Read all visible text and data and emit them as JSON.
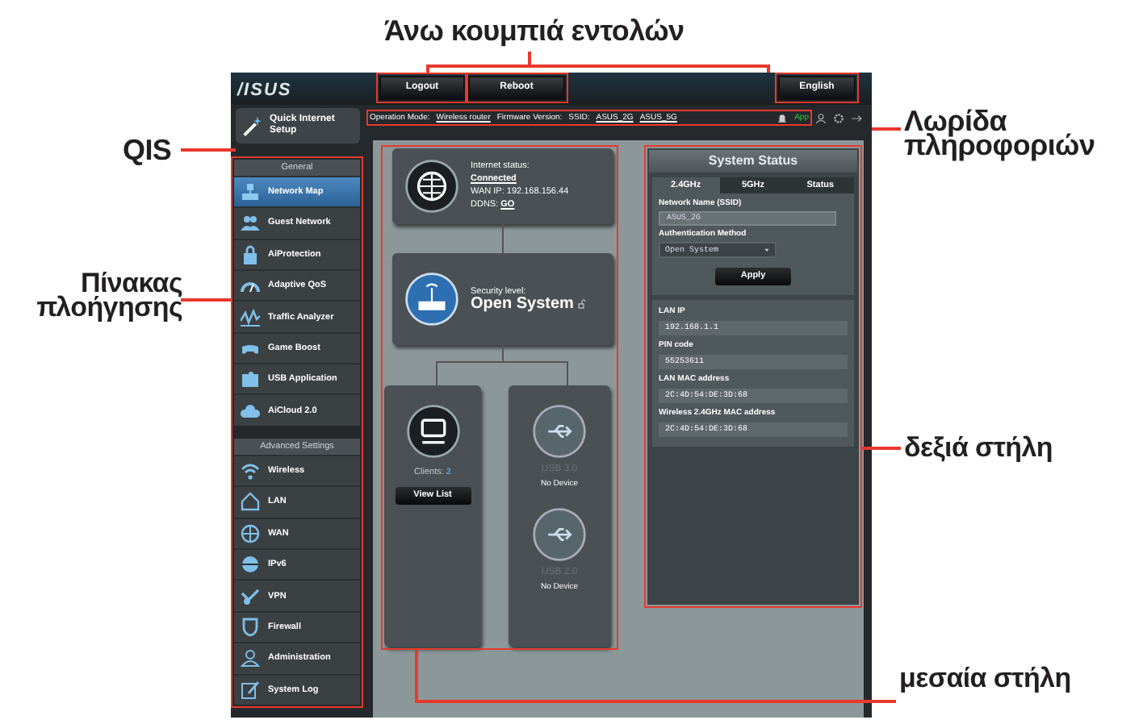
{
  "annotations": [
    {
      "text": "Άνω κουμπιά εντολών"
    },
    {
      "text": "QIS"
    },
    {
      "text": "Πίνακας πλοήγησης"
    },
    {
      "text": "Λωρίδα πληροφοριών"
    },
    {
      "text": "δεξιά στήλη"
    },
    {
      "text": "μεσαία στήλη"
    }
  ],
  "header": {
    "logo": "/ISUS",
    "buttons": [
      "Logout",
      "Reboot",
      "English"
    ]
  },
  "qis": {
    "label": "Quick Internet Setup"
  },
  "sidebar": {
    "sections": [
      {
        "title": "General",
        "items": [
          {
            "label": "Network Map",
            "selected": true
          },
          {
            "label": "Guest Network",
            "selected": false
          },
          {
            "label": "AiProtection",
            "selected": false
          },
          {
            "label": "Adaptive QoS",
            "selected": false
          },
          {
            "label": "Traffic Analyzer",
            "selected": false
          },
          {
            "label": "Game Boost",
            "selected": false
          },
          {
            "label": "USB Application",
            "selected": false
          },
          {
            "label": "AiCloud 2.0",
            "selected": false
          }
        ]
      },
      {
        "title": "Advanced Settings",
        "items": [
          {
            "label": "Wireless",
            "selected": false
          },
          {
            "label": "LAN",
            "selected": false
          },
          {
            "label": "WAN",
            "selected": false
          },
          {
            "label": "IPv6",
            "selected": false
          },
          {
            "label": "VPN",
            "selected": false
          },
          {
            "label": "Firewall",
            "selected": false
          },
          {
            "label": "Administration",
            "selected": false
          },
          {
            "label": "System Log",
            "selected": false
          }
        ]
      }
    ]
  },
  "info_bar": {
    "mode_label": "Operation Mode:",
    "mode": "Wireless router",
    "firmware_label": "Firmware Version:",
    "ssid_label": "SSID:",
    "ssids": [
      "ASUS_2G",
      "ASUS_5G"
    ],
    "app": "App"
  },
  "network_map": {
    "internet": {
      "status_label": "Internet status:",
      "status": "Connected",
      "wan_ip": "WAN IP: 192.168.156.44",
      "ddns_label": "DDNS:",
      "ddns": "GO"
    },
    "security": {
      "label": "Security level:",
      "value": "Open System"
    },
    "clients": {
      "label": "Clients:",
      "count": "2",
      "button": "View List"
    },
    "usb": [
      {
        "name": "USB 3.0",
        "status": "No Device"
      },
      {
        "name": "USB 2.0",
        "status": "No Device"
      }
    ]
  },
  "system_status": {
    "title": "System Status",
    "tabs": [
      {
        "label": "2.4GHz",
        "selected": true
      },
      {
        "label": "5GHz",
        "selected": false
      },
      {
        "label": "Status",
        "selected": false
      }
    ],
    "ssid_label": "Network Name (SSID)",
    "ssid": "ASUS_2G",
    "auth_label": "Authentication Method",
    "auth": "Open System",
    "apply": "Apply",
    "info": [
      {
        "label": "LAN IP",
        "value": "192.168.1.1"
      },
      {
        "label": "PIN code",
        "value": "55253611"
      },
      {
        "label": "LAN MAC address",
        "value": "2C:4D:54:DE:3D:68"
      },
      {
        "label": "Wireless 2.4GHz MAC address",
        "value": "2C:4D:54:DE:3D:68"
      }
    ]
  }
}
